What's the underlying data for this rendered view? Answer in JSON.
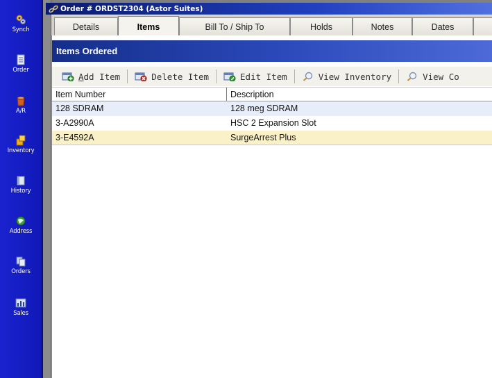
{
  "colors": {
    "sidebar": "#1a23cf",
    "titlebar": "#0a1a6e",
    "section_header": "#152e8a",
    "row_alt": "#e8eef9",
    "row_selected": "#fbf1c8"
  },
  "sidebar": {
    "items": [
      {
        "label": "Synch",
        "icon": "synch-gears-icon"
      },
      {
        "label": "Order",
        "icon": "order-document-icon"
      },
      {
        "label": "A/R",
        "icon": "ar-bucket-icon"
      },
      {
        "label": "Inventory",
        "icon": "inventory-boxes-icon"
      },
      {
        "label": "History",
        "icon": "history-book-icon"
      },
      {
        "label": "Address",
        "icon": "address-globe-icon"
      },
      {
        "label": "Orders",
        "icon": "orders-stack-icon"
      },
      {
        "label": "Sales",
        "icon": "sales-chart-icon"
      }
    ]
  },
  "window": {
    "title": "Order # ORDST2304 (Astor Suites)"
  },
  "tabs": [
    {
      "label": "Details"
    },
    {
      "label": "Items"
    },
    {
      "label": "Bill To / Ship To"
    },
    {
      "label": "Holds"
    },
    {
      "label": "Notes"
    },
    {
      "label": "Dates"
    }
  ],
  "active_tab": "Items",
  "section": {
    "title": "Items Ordered"
  },
  "toolbar": {
    "add_label": "Add Item",
    "add_mnemonic": "A",
    "add_rest": "dd Item",
    "delete_label": "Delete Item",
    "edit_label": "Edit Item",
    "view_inventory_label": "View Inventory",
    "view_other_label": "View Co"
  },
  "grid": {
    "columns": [
      "Item Number",
      "Description"
    ],
    "rows": [
      [
        "128 SDRAM",
        "128 meg SDRAM"
      ],
      [
        "3-A2990A",
        "HSC 2 Expansion Slot"
      ],
      [
        "3-E4592A",
        "SurgeArrest Plus"
      ]
    ],
    "selected_row": 2
  }
}
